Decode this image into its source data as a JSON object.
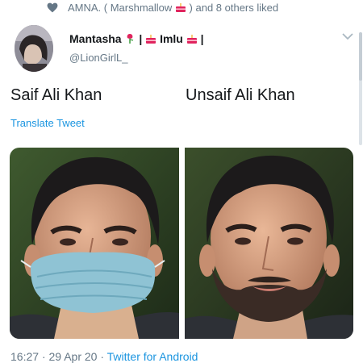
{
  "liked_by": {
    "prefix": "AMNA. ( Marshmallow",
    "suffix": ") and 8 others liked"
  },
  "author": {
    "name_start": "Mantasha",
    "name_sep1": "|",
    "name_mid": "Imlu",
    "name_end": "|",
    "handle": "@LionGirlL_"
  },
  "tweet": {
    "left_text": "Saif Ali Khan",
    "right_text": "Unsaif Ali Khan",
    "translate_label": "Translate Tweet"
  },
  "media": {
    "left_alt": "photo of a man wearing a blue face mask",
    "right_alt": "photo of the same man with a beard, no mask"
  },
  "footer": {
    "time": "16:27",
    "date": "29 Apr 20",
    "sep": "·",
    "client": "Twitter for Android"
  },
  "colors": {
    "link": "#1b95e0",
    "secondary_text": "#657786",
    "mask": "#8fc3d4"
  }
}
